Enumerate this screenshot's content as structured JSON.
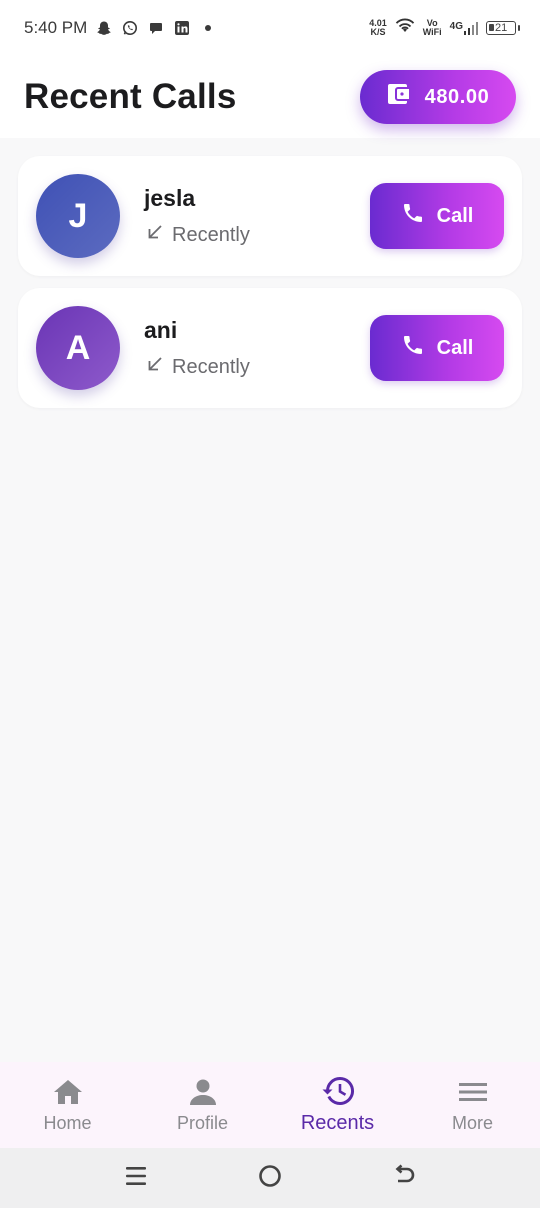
{
  "status_bar": {
    "time": "5:40 PM",
    "net_speed_value": "4.01",
    "net_speed_unit": "K/S",
    "vo_label": "Vo",
    "wifi_label": "WiFi",
    "signal_label": "4G",
    "battery_level": "21",
    "icons": [
      "snapchat-icon",
      "whatsapp-icon",
      "chat-icon",
      "linkedin-icon",
      "dot-icon"
    ]
  },
  "header": {
    "title": "Recent Calls",
    "wallet_balance": "480.00",
    "wallet_icon": "wallet-icon"
  },
  "calls": [
    {
      "initial": "J",
      "name": "jesla",
      "status": "Recently",
      "call_label": "Call",
      "avatar_color": "#3f51b5"
    },
    {
      "initial": "A",
      "name": "ani",
      "status": "Recently",
      "call_label": "Call",
      "avatar_color": "#6a35b5"
    }
  ],
  "bottom_nav": {
    "items": [
      {
        "label": "Home",
        "icon": "home-icon",
        "active": false
      },
      {
        "label": "Profile",
        "icon": "person-icon",
        "active": false
      },
      {
        "label": "Recents",
        "icon": "history-icon",
        "active": true
      },
      {
        "label": "More",
        "icon": "menu-icon",
        "active": false
      }
    ]
  },
  "colors": {
    "accent_start": "#6a2bd0",
    "accent_end": "#d64af0",
    "active_nav": "#5a2aa8",
    "inactive_nav": "#8a8a8e"
  }
}
